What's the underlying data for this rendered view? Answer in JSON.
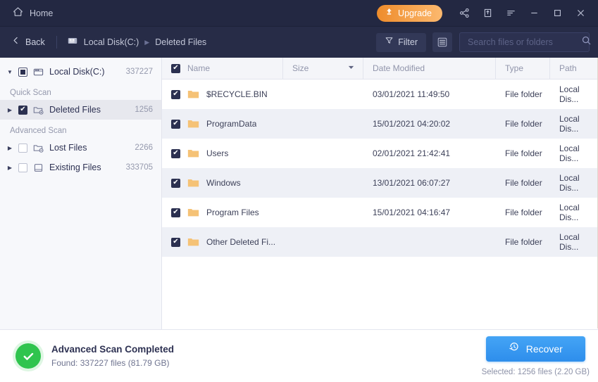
{
  "titlebar": {
    "home_label": "Home",
    "home_icon": "home-icon",
    "upgrade_label": "Upgrade",
    "upgrade_icon": "upgrade-arrow-icon",
    "window_icons": [
      "share-icon",
      "export-icon",
      "menu-icon",
      "minimize-icon",
      "maximize-icon",
      "close-icon"
    ]
  },
  "navbar": {
    "back_label": "Back",
    "back_icon": "chevron-left-icon",
    "disk_icon": "disk-icon",
    "breadcrumbs": [
      "Local Disk(C:)",
      "Deleted Files"
    ],
    "filter_label": "Filter",
    "filter_icon": "funnel-icon",
    "view_icon": "list-view-icon",
    "search_placeholder": "Search files or folders",
    "search_value": "",
    "search_icon": "search-icon"
  },
  "sidebar": {
    "root": {
      "label": "Local Disk(C:)",
      "count": "337227",
      "checkbox": "partial",
      "expanded": true,
      "icon": "disk-icon"
    },
    "groups": [
      {
        "label": "Quick Scan",
        "items": [
          {
            "label": "Deleted Files",
            "count": "1256",
            "checkbox": "on",
            "selected": true,
            "icon": "folder-deleted-icon"
          }
        ]
      },
      {
        "label": "Advanced Scan",
        "items": [
          {
            "label": "Lost Files",
            "count": "2266",
            "checkbox": "off",
            "selected": false,
            "icon": "folder-lost-icon"
          },
          {
            "label": "Existing Files",
            "count": "333705",
            "checkbox": "off",
            "selected": false,
            "icon": "drive-icon"
          }
        ]
      }
    ]
  },
  "table": {
    "select_all_checkbox": "on",
    "columns": {
      "name": "Name",
      "size": "Size",
      "date": "Date Modified",
      "type": "Type",
      "path": "Path"
    },
    "sort_icon": "caret-down-icon",
    "rows": [
      {
        "checked": true,
        "icon": "folder-icon",
        "name": "$RECYCLE.BIN",
        "size": "",
        "date": "03/01/2021 11:49:50",
        "type": "File folder",
        "path": "Local Dis..."
      },
      {
        "checked": true,
        "icon": "folder-icon",
        "name": "ProgramData",
        "size": "",
        "date": "15/01/2021 04:20:02",
        "type": "File folder",
        "path": "Local Dis..."
      },
      {
        "checked": true,
        "icon": "folder-icon",
        "name": "Users",
        "size": "",
        "date": "02/01/2021 21:42:41",
        "type": "File folder",
        "path": "Local Dis..."
      },
      {
        "checked": true,
        "icon": "folder-icon",
        "name": "Windows",
        "size": "",
        "date": "13/01/2021 06:07:27",
        "type": "File folder",
        "path": "Local Dis..."
      },
      {
        "checked": true,
        "icon": "folder-icon",
        "name": "Program Files",
        "size": "",
        "date": "15/01/2021 04:16:47",
        "type": "File folder",
        "path": "Local Dis..."
      },
      {
        "checked": true,
        "icon": "folder-icon",
        "name": "Other Deleted Fi...",
        "size": "",
        "date": "",
        "type": "File folder",
        "path": "Local Dis..."
      }
    ]
  },
  "footer": {
    "status_icon": "success-check-icon",
    "status_title": "Advanced Scan Completed",
    "status_sub": "Found: 337227 files (81.79 GB)",
    "recover_label": "Recover",
    "recover_icon": "restore-clock-icon",
    "selected_text": "Selected: 1256 files (2.20 GB)"
  },
  "colors": {
    "titlebar_bg": "#232842",
    "navbar_bg": "#272c47",
    "accent_orange": "#ee8c2b",
    "accent_blue": "#2e8eec",
    "success_green": "#2fc44e",
    "folder_orange": "#f5c276"
  }
}
